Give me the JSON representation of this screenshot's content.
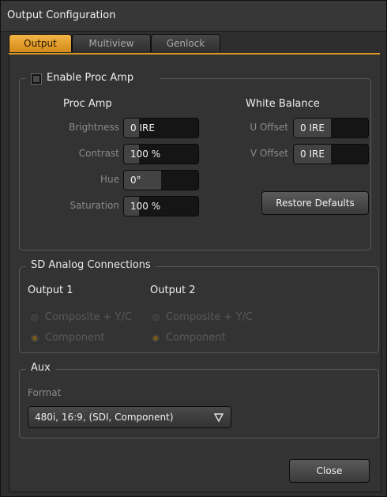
{
  "window": {
    "title": "Output Configuration"
  },
  "tabs": [
    {
      "label": "Output",
      "active": true
    },
    {
      "label": "Multiview",
      "active": false
    },
    {
      "label": "Genlock",
      "active": false
    }
  ],
  "proc_amp_group": {
    "enable_label": "Enable Proc Amp",
    "enabled": false,
    "proc_amp_heading": "Proc Amp",
    "white_balance_heading": "White Balance",
    "fields": [
      {
        "label": "Brightness",
        "value": "0 IRE",
        "level": 0.2
      },
      {
        "label": "Contrast",
        "value": "100 %",
        "level": 0.2
      },
      {
        "label": "Hue",
        "value": "0°",
        "level": 0.5
      },
      {
        "label": "Saturation",
        "value": "100 %",
        "level": 0.2
      }
    ],
    "white_balance": [
      {
        "label": "U Offset",
        "value": "0 IRE",
        "level": 0.5
      },
      {
        "label": "V Offset",
        "value": "0 IRE",
        "level": 0.5
      }
    ],
    "restore_defaults_label": "Restore Defaults"
  },
  "sd_analog": {
    "legend": "SD Analog Connections",
    "output1": {
      "heading": "Output 1",
      "options": [
        "Composite + Y/C",
        "Component"
      ],
      "selected": "Component"
    },
    "output2": {
      "heading": "Output 2",
      "options": [
        "Composite + Y/C",
        "Component"
      ],
      "selected": "Component"
    }
  },
  "aux": {
    "legend": "Aux",
    "format_label": "Format",
    "format_value": "480i, 16:9, (SDI, Component)"
  },
  "footer": {
    "close_label": "Close"
  },
  "colors": {
    "accent": "#d8961f",
    "background": "#333333"
  }
}
